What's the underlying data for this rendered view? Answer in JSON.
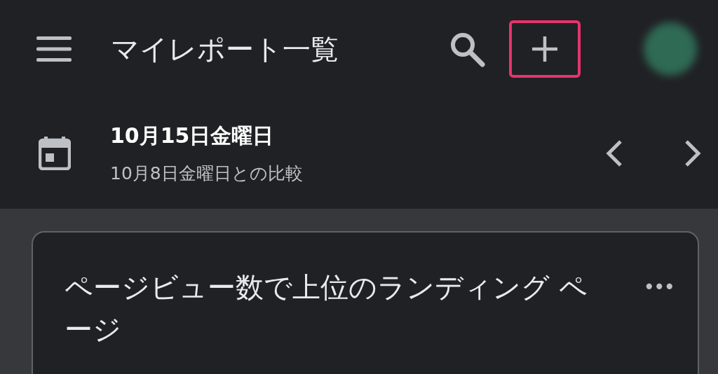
{
  "app_bar": {
    "title": "マイレポート一覧",
    "add_button": {
      "highlighted": true
    }
  },
  "date_bar": {
    "date": "10月15日金曜日",
    "comparison": "10月8日金曜日との比較"
  },
  "cards": [
    {
      "title": "ページビュー数で上位のランディング ページ",
      "menu": "•••"
    }
  ]
}
